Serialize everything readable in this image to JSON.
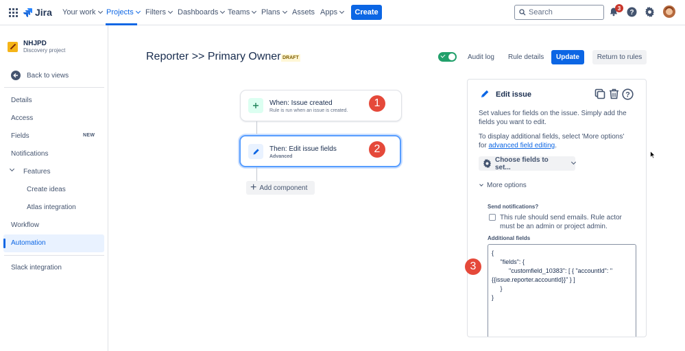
{
  "topnav": {
    "app_name": "Jira",
    "items": [
      {
        "label": "Your work"
      },
      {
        "label": "Projects"
      },
      {
        "label": "Filters"
      },
      {
        "label": "Dashboards"
      },
      {
        "label": "Teams"
      },
      {
        "label": "Plans"
      },
      {
        "label": "Assets"
      },
      {
        "label": "Apps"
      }
    ],
    "create_label": "Create",
    "search_placeholder": "Search",
    "notification_count": "3"
  },
  "sidebar": {
    "project_name": "NHJPD",
    "project_type": "Discovery project",
    "back_label": "Back to views",
    "items": [
      {
        "label": "Details"
      },
      {
        "label": "Access"
      },
      {
        "label": "Fields"
      },
      {
        "label": "Notifications"
      },
      {
        "label": "Features"
      },
      {
        "label": "Create ideas"
      },
      {
        "label": "Atlas integration"
      },
      {
        "label": "Workflow"
      },
      {
        "label": "Automation"
      },
      {
        "label": "Slack integration"
      }
    ],
    "new_badge": "NEW"
  },
  "header": {
    "title": "Reporter >> Primary Owner",
    "status": "DRAFT",
    "audit_log": "Audit log",
    "rule_details": "Rule details",
    "update": "Update",
    "return": "Return to rules"
  },
  "flow": {
    "trigger": {
      "title": "When: Issue created",
      "subtitle": "Rule is run when an issue is created.",
      "step": "1"
    },
    "action": {
      "title": "Then: Edit issue fields",
      "subtitle": "Advanced",
      "step": "2"
    },
    "add_component": "Add component"
  },
  "panel": {
    "title": "Edit issue",
    "desc1": "Set values for fields on the issue. Simply add the fields you want to edit.",
    "desc2_prefix": "To display additional fields, select 'More options' for",
    "desc2_link": "advanced field editing",
    "desc2_suffix": ".",
    "choose_fields": "Choose fields to set...",
    "more_options": "More options",
    "send_notifications_label": "Send notifications?",
    "send_notifications_text": "This rule should send emails. Rule actor must be an admin or project admin.",
    "additional_fields_label": "Additional fields",
    "additional_fields_value": "{\n     \"fields\": {\n          \"customfield_10383\": [ { \"accountId\": \"\n{{issue.reporter.accountId}}\" } ]\n     }\n}",
    "step": "3"
  },
  "colors": {
    "brand": "#0c66e4",
    "step_marker": "#e5493a",
    "toggle_on": "#22a06b"
  }
}
